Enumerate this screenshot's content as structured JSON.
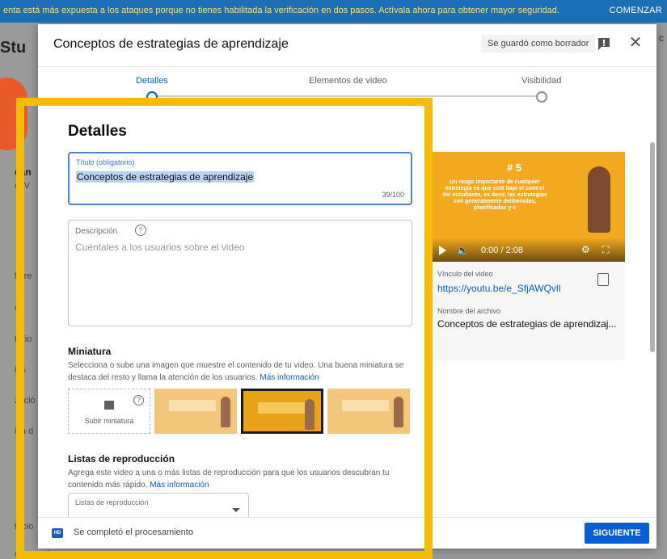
{
  "banner": {
    "message": "enta está más expuesta a los ataques porque no tienes habilitada la verificación en dos pasos. Actívala ahora para obtener mayor seguridad.",
    "action": "COMENZAR"
  },
  "background": {
    "logo": "Stu",
    "left_texts": [
      "can",
      "ocV",
      "le re",
      "cs",
      "tario",
      "ios",
      "zació",
      "ica d",
      "tacio",
      "omentarios"
    ],
    "right_text": "c"
  },
  "dialog": {
    "title": "Conceptos de estrategias de aprendizaje",
    "saved_badge": "Se guardó como borrador",
    "steps": [
      {
        "label": "Detalles",
        "active": true
      },
      {
        "label": "Elementos de video",
        "active": false
      },
      {
        "label": "Visibilidad",
        "active": false
      }
    ],
    "details": {
      "heading": "Detalles",
      "title_field": {
        "label": "Título (obligatorio)",
        "value": "Conceptos de estrategias de aprendizaje",
        "counter": "39/100"
      },
      "description_field": {
        "label": "Descripción",
        "placeholder": "Cuéntales a los usuarios sobre el video"
      },
      "thumbnail": {
        "heading": "Miniatura",
        "text": "Selecciona o sube una imagen que muestre el contenido de tu video. Una buena miniatura se destaca del resto y llama la atención de los usuarios.",
        "link": "Más información",
        "upload_label": "Subir miniatura"
      },
      "playlists": {
        "heading": "Listas de reproducción",
        "text": "Agrega este video a una o más listas de reproducción para que los usuarios descubran tu contenido más rápido.",
        "link": "Más información",
        "select_label": "Listas de reproducción"
      }
    },
    "preview": {
      "slide_number": "# 5",
      "slide_text": "Un rasgo importante de cualquier estrategia es que está bajo el control del estudiante, es decir, las estrategias son generalmente deliberadas, planificadas y c",
      "time": "0:00 / 2:08",
      "link_label": "Vínculo del video",
      "link": "https://youtu.be/e_SfjAWQvlI",
      "file_label": "Nombre del archivo",
      "file_name": "Conceptos de estrategias de aprendizaj..."
    },
    "footer": {
      "hd": "HD",
      "status": "Se completó el procesamiento",
      "next": "SIGUIENTE"
    }
  },
  "colors": {
    "accent": "#065fd4",
    "highlight": "#f5bd02",
    "banner": "#1c6fb5",
    "slide_bg": "#f2a91f"
  }
}
